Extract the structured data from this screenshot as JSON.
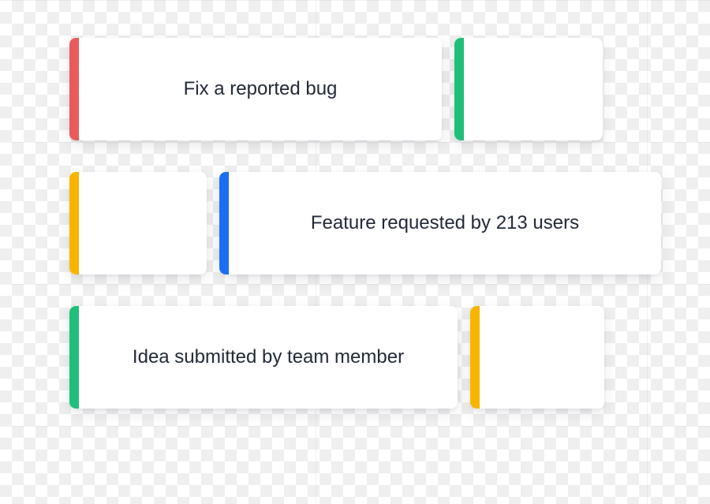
{
  "colors": {
    "red": "#ea5a5a",
    "green": "#1fbf7a",
    "yellow": "#f7b500",
    "blue": "#1b6ef3",
    "text": "#232a38"
  },
  "rows": [
    {
      "main": {
        "label": "Fix a reported bug",
        "stripe": "red"
      },
      "secondary": {
        "stripe": "green"
      }
    },
    {
      "secondary": {
        "stripe": "yellow"
      },
      "main": {
        "label": "Feature requested by 213 users",
        "stripe": "blue"
      }
    },
    {
      "main": {
        "label": "Idea submitted by team member",
        "stripe": "green"
      },
      "secondary": {
        "stripe": "yellow"
      }
    }
  ]
}
